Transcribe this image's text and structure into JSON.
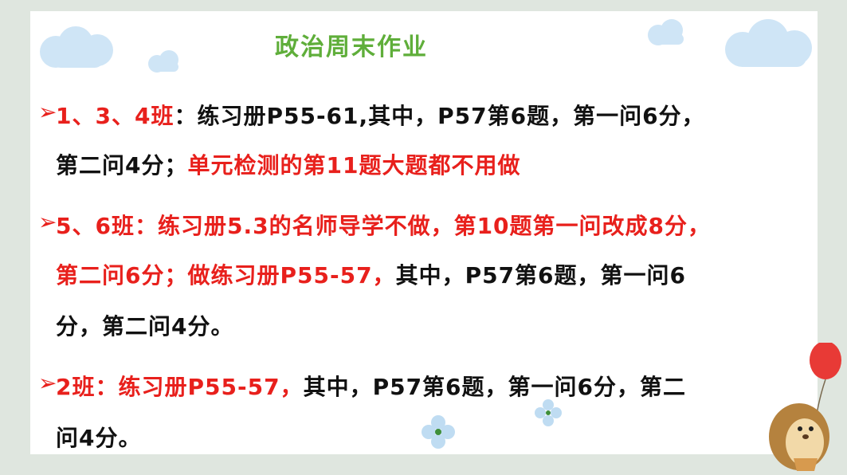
{
  "title": "政治周末作业",
  "bullet_glyph": "➢",
  "items": [
    {
      "lines": [
        [
          {
            "t": "1、3、4班",
            "c": "red"
          },
          {
            "t": "：练习册P55-61,其中，P57第6题，第一问6分，",
            "c": "black"
          }
        ],
        [
          {
            "t": "第二问4分；",
            "c": "black"
          },
          {
            "t": "单元检测的第11题大题都不用做",
            "c": "red"
          }
        ]
      ]
    },
    {
      "lines": [
        [
          {
            "t": "5、6班：练习册5.3的名师导学不做，第10题第一问改成8分，",
            "c": "red"
          }
        ],
        [
          {
            "t": "第二问6分；做练习册P55-57，",
            "c": "red"
          },
          {
            "t": "其中，P57第6题，第一问6",
            "c": "black"
          }
        ],
        [
          {
            "t": "分，第二问4分。",
            "c": "black"
          }
        ]
      ]
    },
    {
      "lines": [
        [
          {
            "t": "2班：练习册P55-57，",
            "c": "red"
          },
          {
            "t": "其中，P57第6题，第一问6分，第二",
            "c": "black"
          }
        ],
        [
          {
            "t": "问4分。",
            "c": "black"
          }
        ]
      ]
    }
  ],
  "colors": {
    "title": "#5fae3a",
    "red": "#e8201c",
    "black": "#111111",
    "background": "#dfe6df"
  }
}
